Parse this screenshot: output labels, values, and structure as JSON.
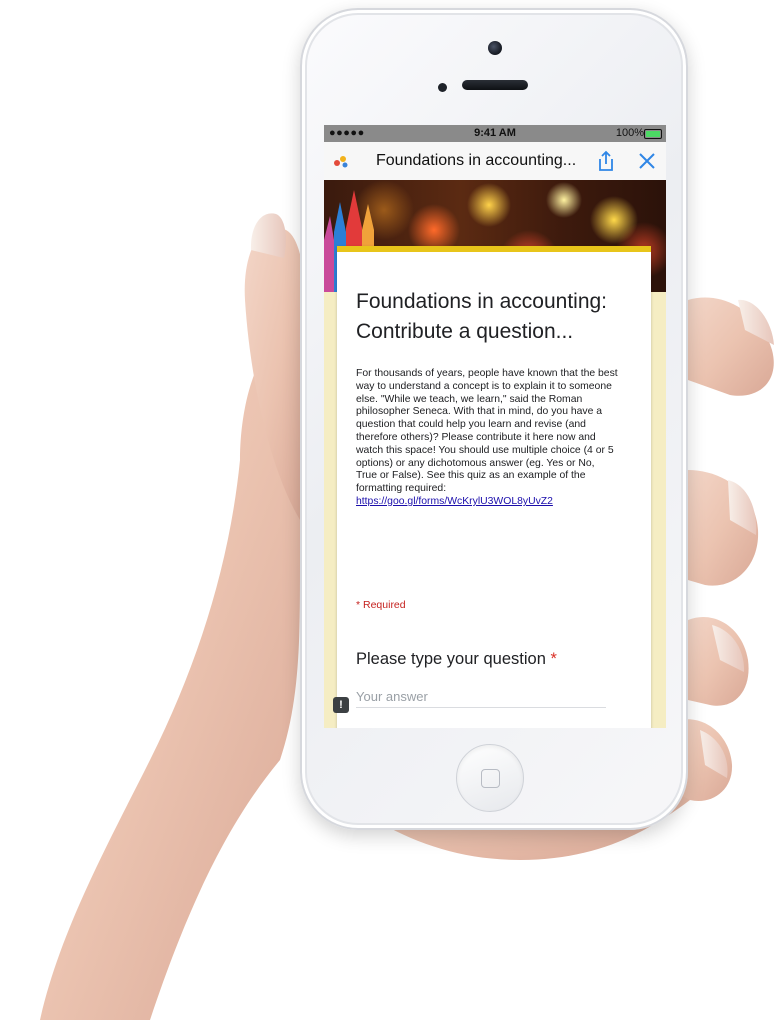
{
  "status_bar": {
    "signal": "●●●●● ",
    "time": "9:41 AM",
    "battery_text": "100%"
  },
  "nav": {
    "title": "Foundations in accounting...",
    "favicon_icon": "form-favicon-icon",
    "share_icon": "share-icon",
    "close_icon": "close-icon",
    "accent_color": "#2f86e6"
  },
  "form": {
    "title": "Foundations in accounting: Contribute a question...",
    "description": "For thousands of years, people have known that the best way to understand a concept is to explain it to someone else. \"While we teach, we learn,\" said the Roman philosopher Seneca. With that in mind, do you have a question that could help you learn and revise (and therefore others)? Please contribute it here now and watch this space!  You should use multiple choice (4 or 5 options)  or any dichotomous answer (eg. Yes or No, True or False). See this quiz as an example of the formatting required:",
    "link": "https://goo.gl/forms/WcKrylU3WOL8yUvZ2",
    "required_note": "* Required",
    "question_label": "Please type your question",
    "question_required_mark": "*",
    "answer_placeholder": "Your answer",
    "feedback_icon": "feedback-icon",
    "header_color": "#e8c51a",
    "background_color": "#f5edc3"
  }
}
